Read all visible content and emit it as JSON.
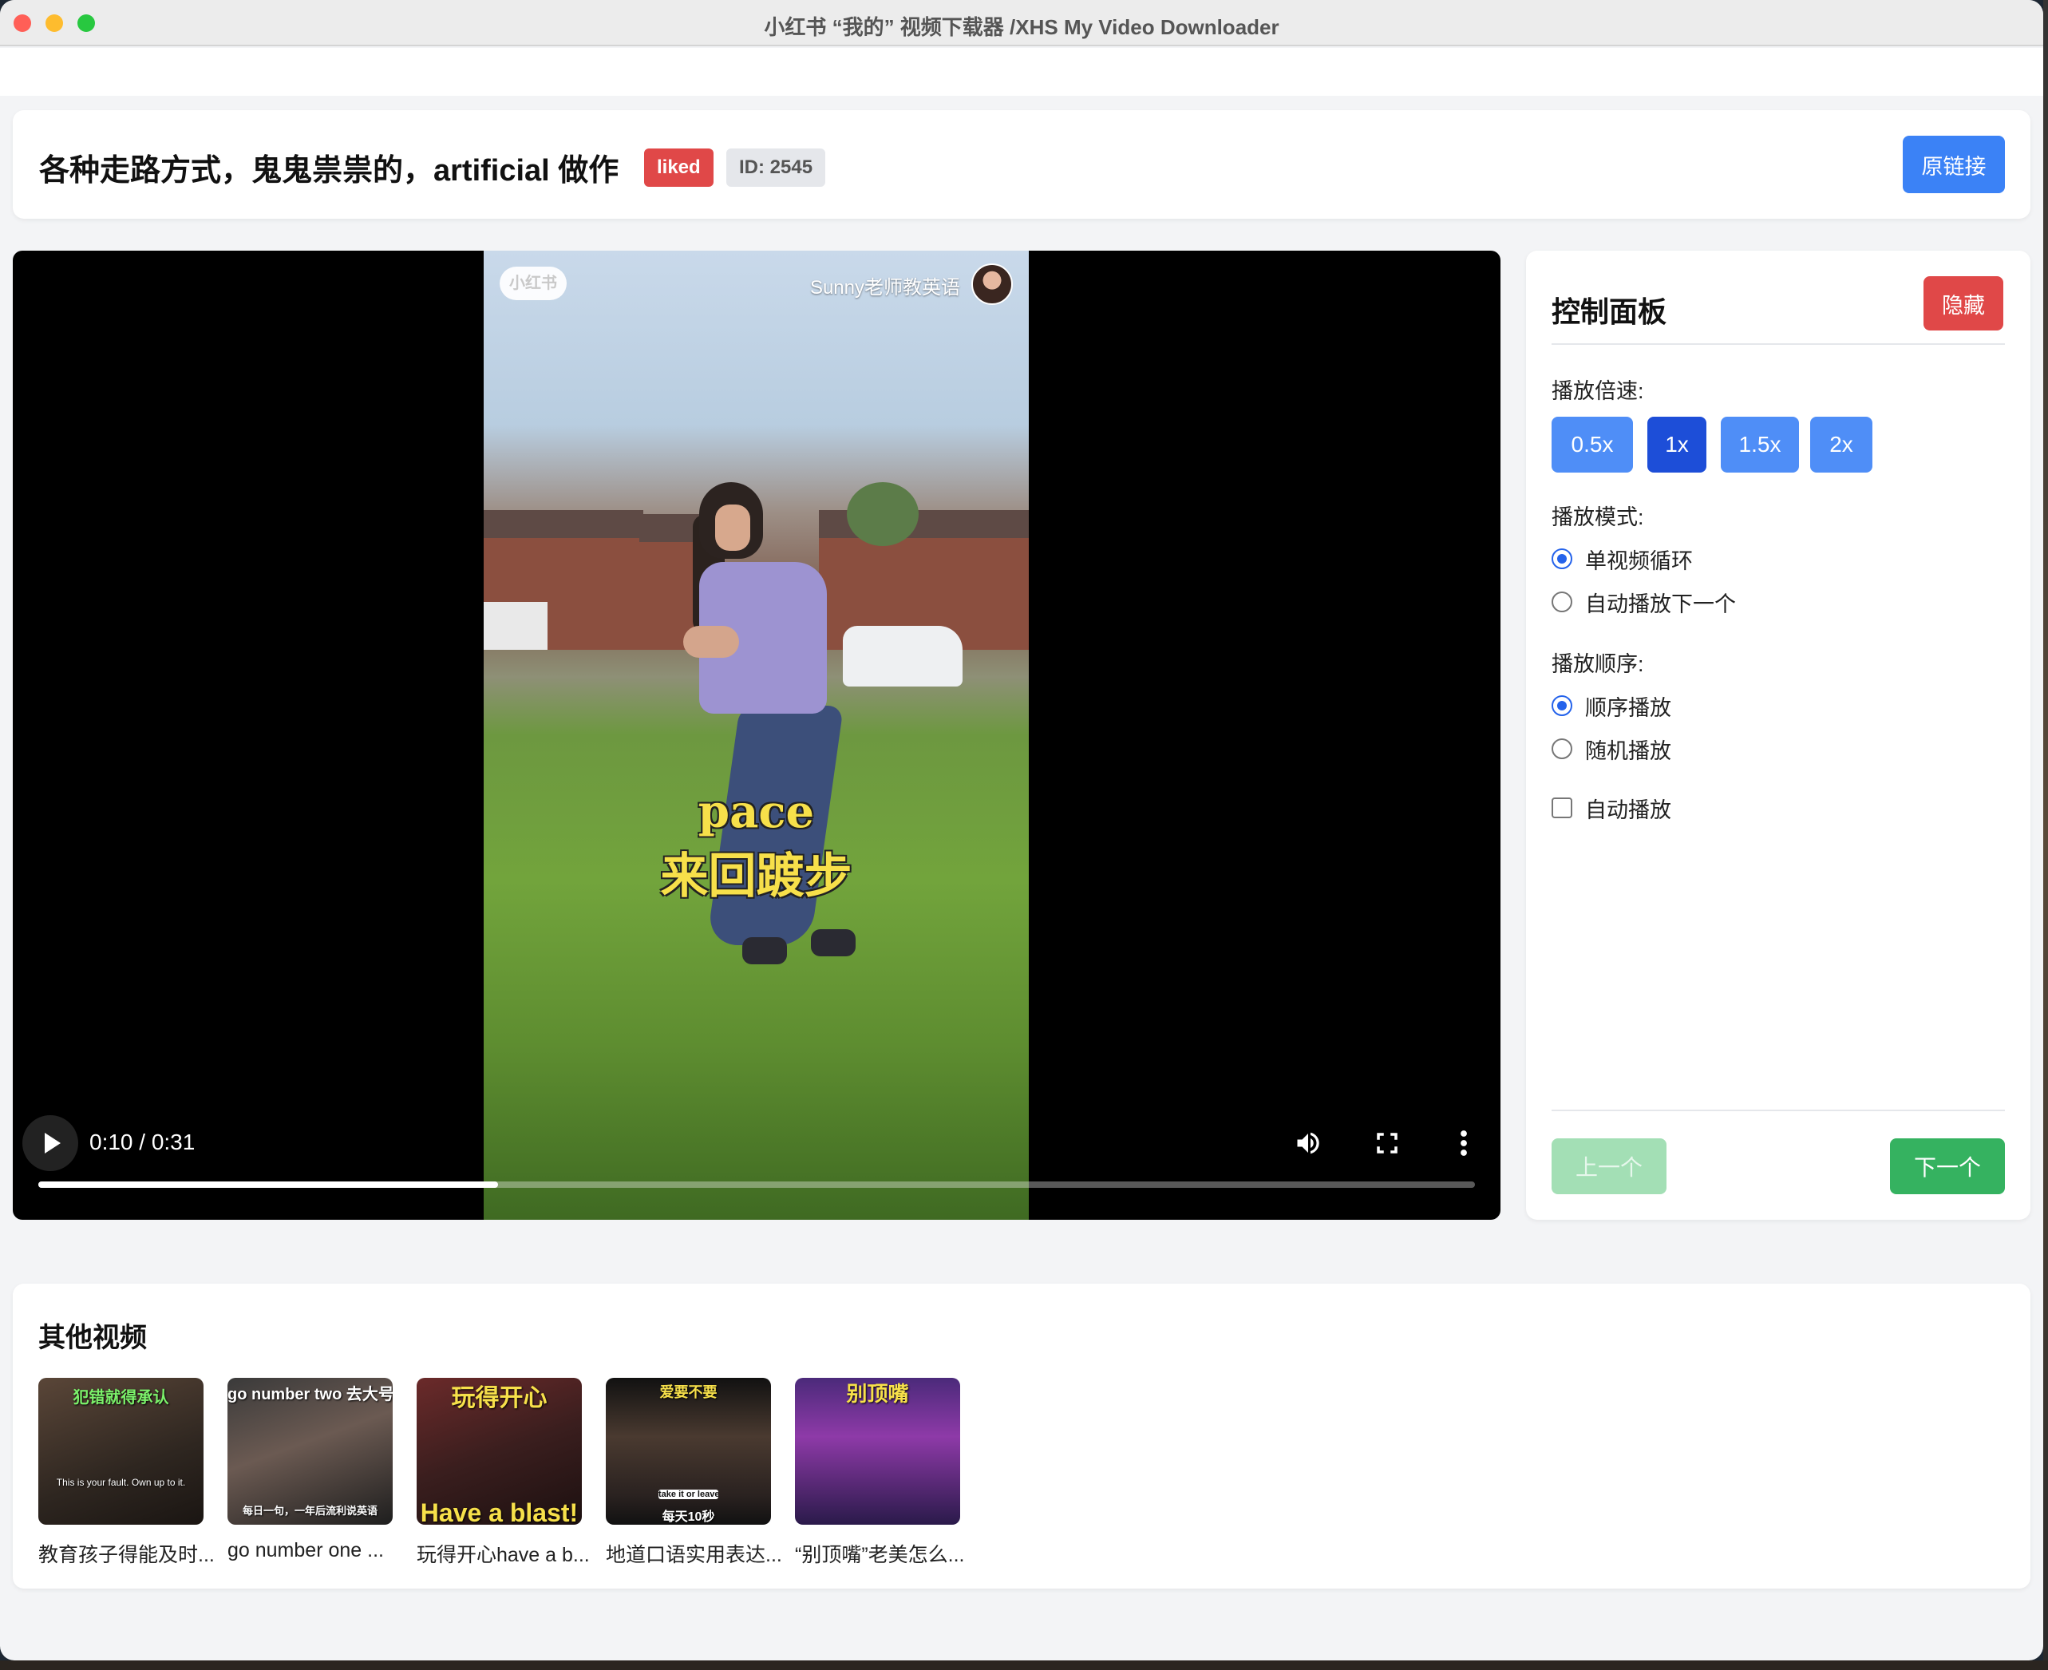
{
  "window": {
    "title": "小红书 “我的” 视频下载器 /XHS My Video Downloader"
  },
  "header": {
    "title": "各种走路方式，鬼鬼祟祟的，artificial 做作",
    "badge_liked": "liked",
    "badge_id": "ID: 2545",
    "origin_button": "原链接"
  },
  "player": {
    "watermark": "小红书",
    "author": "Sunny老师教英语",
    "subtitle_en": "pace",
    "subtitle_zh": "来回踱步",
    "time": "0:10 / 0:31",
    "progress_fraction": 0.32
  },
  "panel": {
    "title": "控制面板",
    "hide_button": "隐藏",
    "speed_label": "播放倍速:",
    "speeds": [
      {
        "label": "0.5x",
        "active": false
      },
      {
        "label": "1x",
        "active": true
      },
      {
        "label": "1.5x",
        "active": false
      },
      {
        "label": "2x",
        "active": false
      }
    ],
    "mode_label": "播放模式:",
    "modes": [
      {
        "label": "单视频循环",
        "checked": true
      },
      {
        "label": "自动播放下一个",
        "checked": false
      }
    ],
    "order_label": "播放顺序:",
    "orders": [
      {
        "label": "顺序播放",
        "checked": true
      },
      {
        "label": "随机播放",
        "checked": false
      }
    ],
    "autoplay_label": "自动播放",
    "autoplay_checked": false,
    "prev_button": "上一个",
    "next_button": "下一个"
  },
  "others": {
    "title": "其他视频",
    "items": [
      {
        "caption": "教育孩子得能及时...",
        "thumb_top": "犯错就得承认",
        "thumb_mid": "This is your fault. Own up to it.",
        "thumb_bottom": ""
      },
      {
        "caption": "go number one ...",
        "thumb_top": "go number two 去大号",
        "thumb_mid": "每日一句，一年后流利说英语",
        "thumb_bottom": ""
      },
      {
        "caption": "玩得开心have a b...",
        "thumb_top": "玩得开心",
        "thumb_mid": "",
        "thumb_bottom": "Have a blast!"
      },
      {
        "caption": "地道口语实用表达...",
        "thumb_top": "爱要不要",
        "thumb_mid": "take it or leave",
        "thumb_bottom": "每天10秒"
      },
      {
        "caption": "“别顶嘴”老美怎么...",
        "thumb_top": "别顶嘴",
        "thumb_mid": "",
        "thumb_bottom": ""
      }
    ]
  },
  "colors": {
    "primary": "#3b82f6",
    "danger": "#e04848",
    "success": "#35b260",
    "speed_active": "#1d4ed8"
  }
}
